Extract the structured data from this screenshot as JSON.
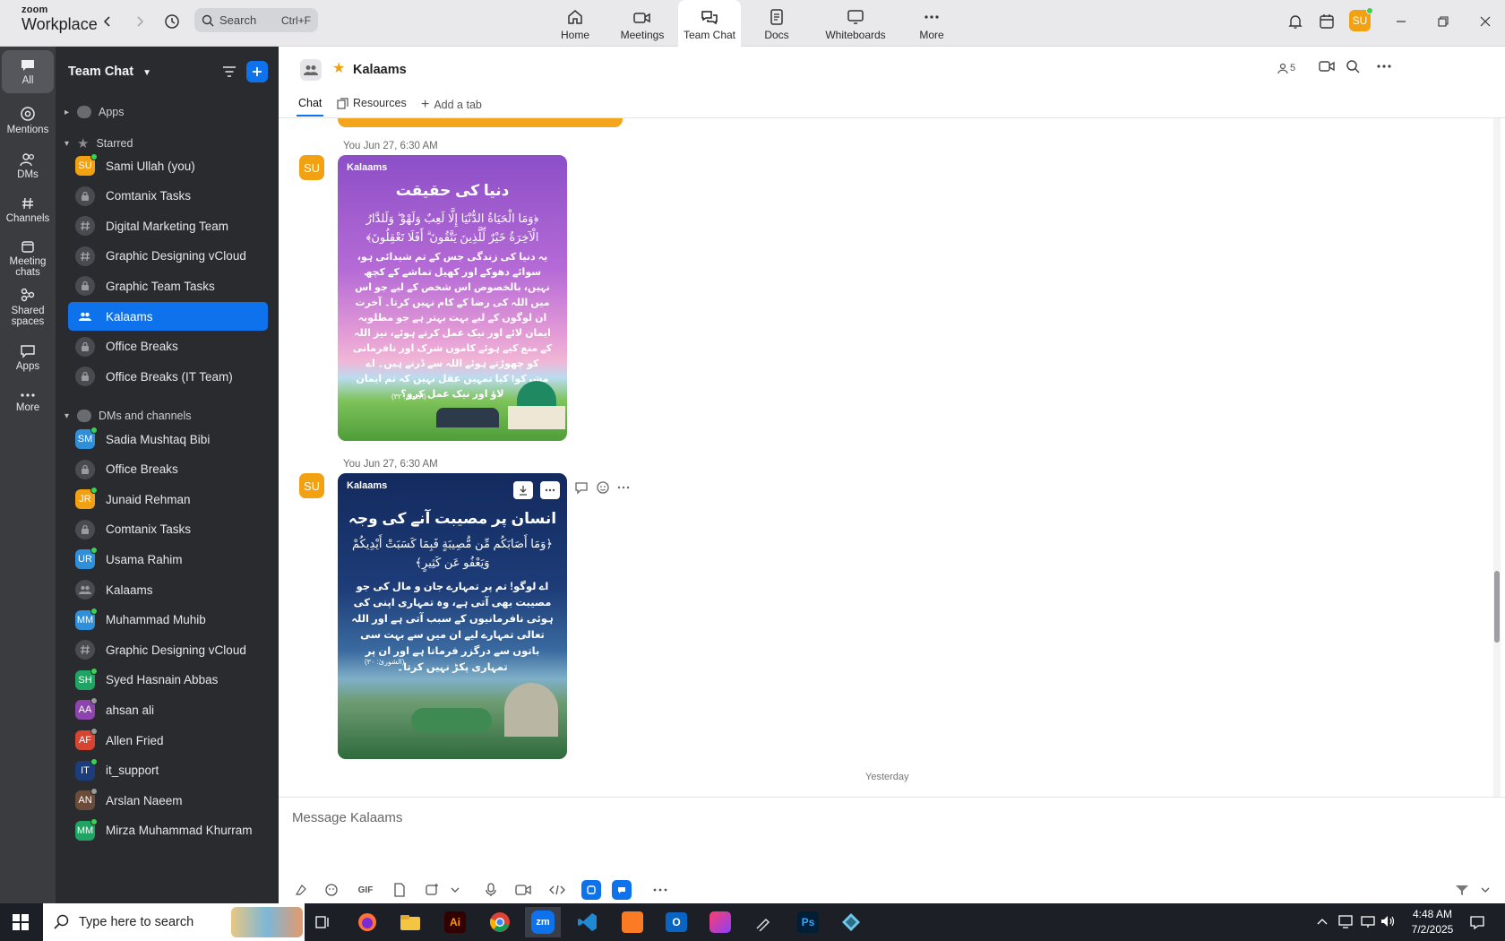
{
  "brand": {
    "line1": "zoom",
    "line2": "Workplace"
  },
  "search": {
    "label": "Search",
    "shortcut": "Ctrl+F"
  },
  "nav_tabs": [
    {
      "label": "Home",
      "icon": "home-icon"
    },
    {
      "label": "Meetings",
      "icon": "video-camera-icon"
    },
    {
      "label": "Team Chat",
      "icon": "chat-bubbles-icon",
      "active": true
    },
    {
      "label": "Docs",
      "icon": "document-icon"
    },
    {
      "label": "Whiteboards",
      "icon": "whiteboard-icon"
    },
    {
      "label": "More",
      "icon": "more-dots-icon"
    }
  ],
  "profile_initials": "SU",
  "rail": [
    {
      "label": "All",
      "active": true
    },
    {
      "label": "Mentions"
    },
    {
      "label": "DMs"
    },
    {
      "label": "Channels"
    },
    {
      "label": "Meeting chats"
    },
    {
      "label": "Shared spaces"
    },
    {
      "label": "Apps"
    },
    {
      "label": "More"
    }
  ],
  "side": {
    "title": "Team Chat",
    "sections": {
      "apps": "Apps",
      "starred": "Starred",
      "dms": "DMs and channels"
    },
    "starred": [
      {
        "label": "Sami Ullah (you)",
        "initials": "SU",
        "color": "#f1a112",
        "type": "user",
        "status": "#39d353"
      },
      {
        "label": "Comtanix Tasks",
        "type": "lock"
      },
      {
        "label": "Digital Marketing Team",
        "type": "hash"
      },
      {
        "label": "Graphic Designing vCloud",
        "type": "hash"
      },
      {
        "label": "Graphic Team Tasks",
        "type": "lock"
      },
      {
        "label": "Kalaams",
        "type": "group",
        "active": true
      },
      {
        "label": "Office Breaks",
        "type": "lock"
      },
      {
        "label": "Office Breaks (IT Team)",
        "type": "lock"
      }
    ],
    "dms": [
      {
        "label": "Sadia Mushtaq Bibi",
        "initials": "SM",
        "color": "#2f8fd9",
        "type": "user",
        "status": "#39d353"
      },
      {
        "label": "Office Breaks",
        "type": "lock"
      },
      {
        "label": "Junaid Rehman",
        "initials": "JR",
        "color": "#f1a112",
        "type": "user",
        "status": "#39d353"
      },
      {
        "label": "Comtanix Tasks",
        "type": "lock"
      },
      {
        "label": "Usama Rahim",
        "initials": "UR",
        "color": "#2f8fd9",
        "type": "user",
        "status": "#39d353"
      },
      {
        "label": "Kalaams",
        "type": "group"
      },
      {
        "label": "Muhammad Muhib",
        "initials": "MM",
        "color": "#2f8fd9",
        "type": "user",
        "status": "#39d353"
      },
      {
        "label": "Graphic Designing vCloud",
        "type": "hash"
      },
      {
        "label": "Syed Hasnain Abbas",
        "initials": "SH",
        "color": "#1fa463",
        "type": "user",
        "status": "#39d353"
      },
      {
        "label": "ahsan ali",
        "initials": "AA",
        "color": "#8e44ad",
        "type": "user",
        "status": "#9a9a9a"
      },
      {
        "label": "Allen Fried",
        "initials": "AF",
        "color": "#d64532",
        "type": "user",
        "status": "#9a9a9a"
      },
      {
        "label": "it_support",
        "initials": "IT",
        "color": "#1d3d7a",
        "type": "user",
        "status": "#39d353"
      },
      {
        "label": "Arslan Naeem",
        "initials": "AN",
        "color": "#6b4b3a",
        "type": "user",
        "status": "#9a9a9a"
      },
      {
        "label": "Mirza Muhammad Khurram",
        "initials": "MM",
        "color": "#1fa463",
        "type": "user",
        "status": "#39d353"
      }
    ]
  },
  "chat": {
    "channel": "Kalaams",
    "members": "5",
    "tabs": {
      "chat": "Chat",
      "resources": "Resources",
      "add": "Add a tab"
    },
    "messages": [
      {
        "sender": "You Jun 27, 6:30 AM",
        "avatar": "SU",
        "card": {
          "brand": "Kalaams",
          "title": "دنیا کی حقیقت",
          "verse": "﴿وَمَا الْحَيَاةُ الدُّنْيَا إِلَّا لَعِبٌ وَلَهْوٌ ۖ وَلَلدَّارُ الْآخِرَةُ خَيْرٌ لِّلَّذِينَ يَتَّقُونَ ۗ أَفَلَا تَعْقِلُونَ﴾",
          "body": "یہ دنیا کی زندگی جس کے تم شیدائی ہو، سوائے دھوکے اور کھیل تماشے کے کچھ نہیں، بالخصوص اس شخص کے لیے جو اس میں اللہ کی رضا کے کام نہیں کرتا۔ آخرت ان لوگوں کے لیے بہت بہتر ہے جو مطلوبہ ایمان لائے اور نیک عمل کرتے ہوئے، نیز اللہ کے منع کیے ہوئے کاموں شرک اور نافرمانی کو چھوڑتے ہوئے اللہ سے ڈرتے ہیں۔ اے مشرکو! کیا تمہیں عقل نہیں کہ تم ایمان لاؤ اور نیک عمل کرو؟",
          "ref": "(الانعام: ۳۲)"
        }
      },
      {
        "sender": "You Jun 27, 6:30 AM",
        "avatar": "SU",
        "card": {
          "brand": "Kalaams",
          "title": "انسان پر مصیبت آنے کی وجہ",
          "verse": "﴿وَمَا أَصَابَكُم مِّن مُّصِيبَةٍ فَبِمَا كَسَبَتْ أَيْدِيكُمْ وَيَعْفُو عَن كَثِيرٍ﴾",
          "body": "اے لوگو! تم پر تمہارے جان و مال کی جو مصیبت بھی آتی ہے، وہ تمہاری اپنی کی ہوئی نافرمانیوں کے سبب آتی ہے اور اللہ تعالی تمہارے لیے ان میں سے بہت سی باتوں سے درگزر فرماتا ہے اور ان پر تمہاری پکڑ نہیں کرتا۔",
          "ref": "(الشوریٰ: ۳۰)"
        }
      }
    ],
    "divider": "Yesterday"
  },
  "composer": {
    "placeholder": "Message Kalaams",
    "gif": "GIF"
  },
  "taskbar": {
    "search_placeholder": "Type here to search",
    "time": "4:48 AM",
    "date": "7/2/2025"
  }
}
